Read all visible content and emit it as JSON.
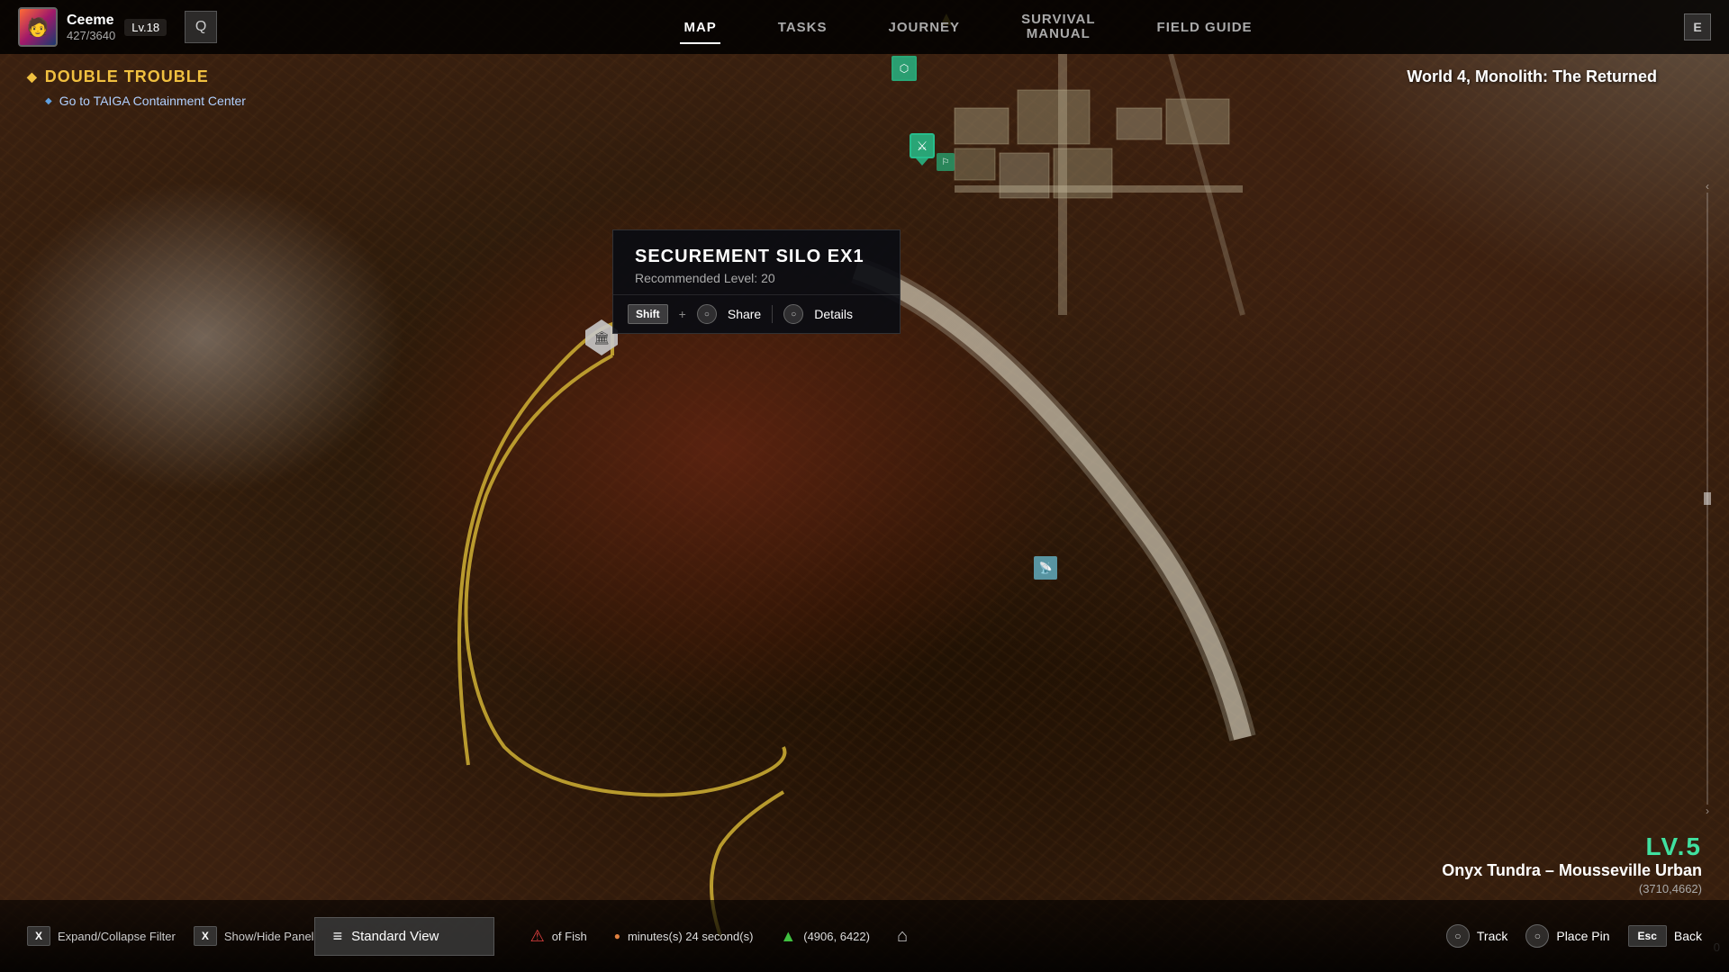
{
  "player": {
    "name": "Ceeme",
    "xp_current": "427",
    "xp_total": "3640",
    "level": "Lv.18",
    "avatar_emoji": "🧑"
  },
  "nav": {
    "inventory_key": "Q",
    "tabs": [
      {
        "id": "map",
        "label": "MAP",
        "active": true
      },
      {
        "id": "tasks",
        "label": "TASKS",
        "active": false
      },
      {
        "id": "journey",
        "label": "JOURNEY",
        "active": false
      },
      {
        "id": "survival_manual",
        "label1": "SURVIVAL",
        "label2": "MANUAL",
        "active": false
      },
      {
        "id": "field_guide",
        "label": "FIELD GUIDE",
        "active": false
      }
    ],
    "e_key": "E"
  },
  "quest": {
    "title": "DOUBLE TROUBLE",
    "objective": "Go to TAIGA Containment Center"
  },
  "world": {
    "label": "World 4, Monolith: The Returned"
  },
  "tooltip": {
    "name": "SECUREMENT SILO EX1",
    "level_label": "Recommended Level: 20",
    "shift_key": "Shift",
    "plus": "+",
    "share_label": "Share",
    "details_label": "Details"
  },
  "map_marker": {
    "symbol": "🏛"
  },
  "bottom": {
    "standard_view_label": "Standard View",
    "view_icon": "≡",
    "status_timer": "minutes(s) 24 second(s)",
    "fish_label": "of Fish",
    "coordinates": "(4906, 6422)",
    "key_hints": [
      {
        "key": "X",
        "label": "Expand/Collapse Filter"
      },
      {
        "key": "X",
        "label": "Show/Hide Panel"
      }
    ],
    "actions": [
      {
        "label": "Track",
        "key_icon": "○"
      },
      {
        "label": "Place Pin",
        "key_icon": "○"
      },
      {
        "label": "Back",
        "key": "Esc"
      }
    ]
  },
  "location": {
    "lv": "LV.5",
    "name": "Onyx Tundra – Mousseville Urban",
    "coords": "(3710,4662)"
  },
  "colors": {
    "accent_green": "#40e0a0",
    "quest_gold": "#f0c040",
    "quest_blue": "#b0d0ff",
    "nav_active": "#ffffff",
    "nav_inactive": "#aaaaaa"
  }
}
